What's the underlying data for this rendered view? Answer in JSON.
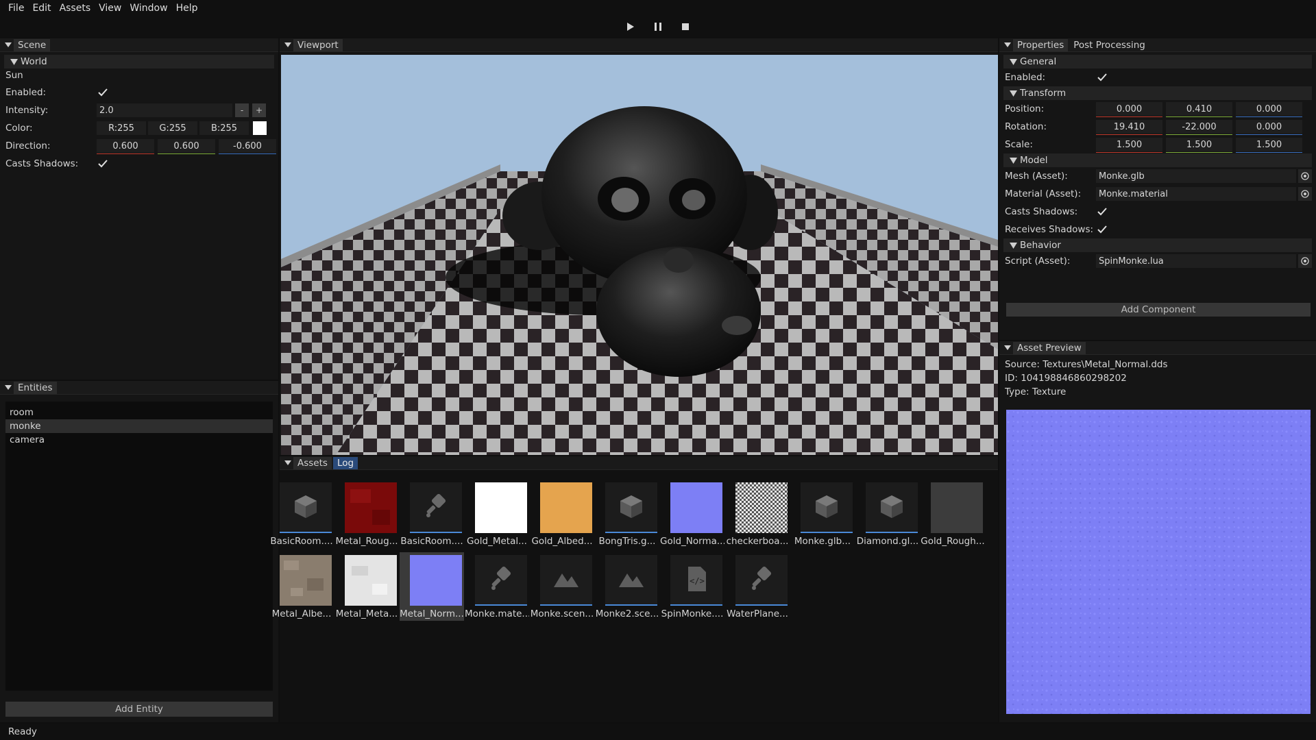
{
  "menu": [
    "File",
    "Edit",
    "Assets",
    "View",
    "Window",
    "Help"
  ],
  "toolbar": {
    "play": "play-icon",
    "pause": "pause-icon",
    "stop": "stop-icon"
  },
  "scene": {
    "tab": "Scene",
    "section": "World",
    "object": "Sun",
    "enabled_label": "Enabled:",
    "intensity_label": "Intensity:",
    "intensity_value": "2.0",
    "minus": "-",
    "plus": "+",
    "color_label": "Color:",
    "color_r": "R:255",
    "color_g": "G:255",
    "color_b": "B:255",
    "color_swatch": "#ffffff",
    "direction_label": "Direction:",
    "direction": [
      "0.600",
      "0.600",
      "-0.600"
    ],
    "casts_shadows_label": "Casts Shadows:"
  },
  "entities": {
    "tab": "Entities",
    "items": [
      "room",
      "monke",
      "camera"
    ],
    "selected": "monke",
    "add_button": "Add Entity"
  },
  "viewport": {
    "tab": "Viewport",
    "sky_color": "#a4bfdb"
  },
  "assets": {
    "tabs": [
      "Assets",
      "Log"
    ],
    "items": [
      {
        "name": "BasicRoom....",
        "icon": "cube"
      },
      {
        "name": "Metal_Roug...",
        "icon": "texture-red"
      },
      {
        "name": "BasicRoom....",
        "icon": "material"
      },
      {
        "name": "Gold_Metal...",
        "icon": "texture-white"
      },
      {
        "name": "Gold_Albed...",
        "icon": "texture-gold"
      },
      {
        "name": "BongTris.g...",
        "icon": "cube"
      },
      {
        "name": "Gold_Norma...",
        "icon": "texture-normal"
      },
      {
        "name": "checkerboa...",
        "icon": "texture-noise"
      },
      {
        "name": "Monke.glb...",
        "icon": "cube"
      },
      {
        "name": "Diamond.gl...",
        "icon": "cube"
      },
      {
        "name": "Gold_Rough...",
        "icon": "texture-dark"
      },
      {
        "name": "Metal_Albe...",
        "icon": "texture-stone"
      },
      {
        "name": "Metal_Meta...",
        "icon": "texture-light"
      },
      {
        "name": "Metal_Norm...",
        "icon": "texture-normal"
      },
      {
        "name": "Monke.mate...",
        "icon": "material"
      },
      {
        "name": "Monke.scen...",
        "icon": "scene"
      },
      {
        "name": "Monke2.sce...",
        "icon": "scene"
      },
      {
        "name": "SpinMonke....",
        "icon": "script"
      },
      {
        "name": "WaterPlane...",
        "icon": "material"
      }
    ],
    "selected_index": 13
  },
  "properties": {
    "tabs": [
      "Properties",
      "Post Processing"
    ],
    "general": "General",
    "enabled_label": "Enabled:",
    "transform": "Transform",
    "position_label": "Position:",
    "position": [
      "0.000",
      "0.410",
      "0.000"
    ],
    "rotation_label": "Rotation:",
    "rotation": [
      "19.410",
      "-22.000",
      "0.000"
    ],
    "scale_label": "Scale:",
    "scale": [
      "1.500",
      "1.500",
      "1.500"
    ],
    "model": "Model",
    "mesh_label": "Mesh (Asset):",
    "mesh_value": "Monke.glb",
    "material_label": "Material (Asset):",
    "material_value": "Monke.material",
    "casts_label": "Casts Shadows:",
    "receives_label": "Receives Shadows:",
    "behavior": "Behavior",
    "script_label": "Script (Asset):",
    "script_value": "SpinMonke.lua",
    "add_component": "Add Component"
  },
  "preview": {
    "tab": "Asset Preview",
    "source": "Source: Textures\\Metal_Normal.dds",
    "id": "ID: 104198846860298202",
    "type": "Type: Texture",
    "texture_color": "#7d7ff5"
  },
  "status": "Ready",
  "colors": {
    "x_axis": "#c0392b",
    "y_axis": "#7fae3a",
    "z_axis": "#3a6fc0",
    "accent": "#4a8ad8"
  }
}
